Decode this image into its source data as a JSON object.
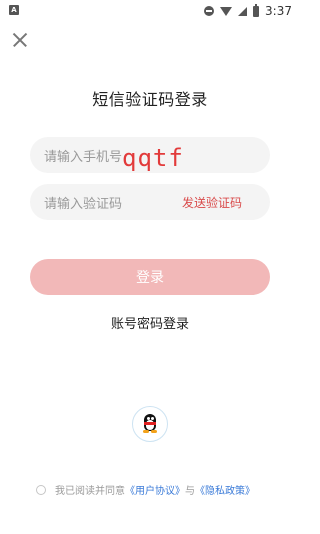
{
  "status_bar": {
    "left_icon": "A",
    "time": "3:37"
  },
  "page": {
    "title": "短信验证码登录",
    "phone_placeholder": "请输入手机号",
    "code_placeholder": "请输入验证码",
    "send_code_label": "发送验证码",
    "overlay_text": "qqtf",
    "login_label": "登录",
    "alt_login_label": "账号密码登录"
  },
  "agreement": {
    "prefix": "我已阅读并同意",
    "user_agreement": "《用户协议》",
    "and": "与",
    "privacy_policy": "《隐私政策》"
  },
  "colors": {
    "accent": "#d94b4b",
    "login_button_disabled": "#f2b8b8",
    "link": "#3b7bd8"
  }
}
